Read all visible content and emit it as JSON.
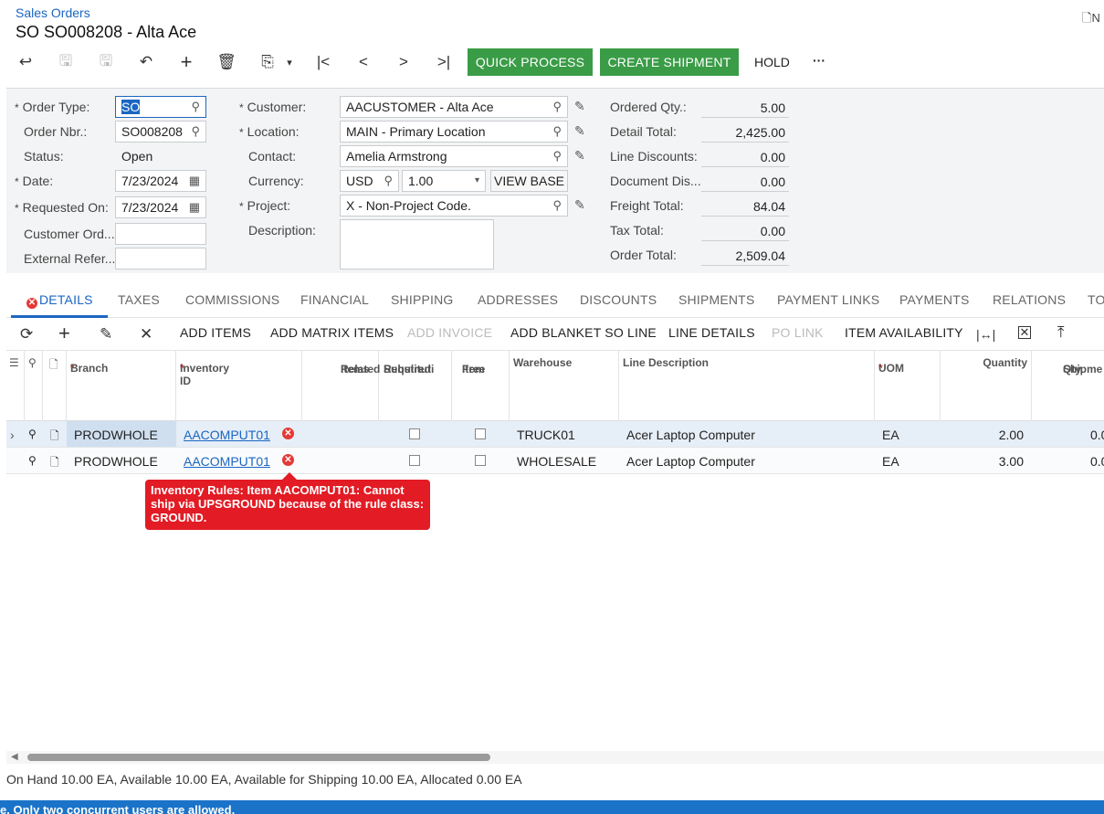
{
  "breadcrumb": "Sales Orders",
  "page_title": "SO SO008208 - Alta Ace",
  "notes_label": "N",
  "toolbar": {
    "quick_process": "QUICK PROCESS",
    "create_shipment": "CREATE SHIPMENT",
    "hold": "HOLD",
    "more": "···"
  },
  "form": {
    "order_type_label": "Order Type:",
    "order_type": "SO",
    "order_nbr_label": "Order Nbr.:",
    "order_nbr": "SO008208",
    "status_label": "Status:",
    "status": "Open",
    "date_label": "Date:",
    "date": "7/23/2024",
    "requested_on_label": "Requested On:",
    "requested_on": "7/23/2024",
    "customer_ord_label": "Customer Ord...",
    "external_ref_label": "External Refer...",
    "customer_label": "Customer:",
    "customer": "AACUSTOMER - Alta Ace",
    "location_label": "Location:",
    "location": "MAIN - Primary Location",
    "contact_label": "Contact:",
    "contact": "Amelia Armstrong",
    "currency_label": "Currency:",
    "currency": "USD",
    "rate": "1.00",
    "view_base": "VIEW BASE",
    "project_label": "Project:",
    "project": "X - Non-Project Code.",
    "description_label": "Description:"
  },
  "totals": {
    "ordered_qty_label": "Ordered Qty.:",
    "ordered_qty": "5.00",
    "detail_total_label": "Detail Total:",
    "detail_total": "2,425.00",
    "line_discounts_label": "Line Discounts:",
    "line_discounts": "0.00",
    "document_dis_label": "Document Dis...",
    "document_dis": "0.00",
    "freight_total_label": "Freight Total:",
    "freight_total": "84.04",
    "tax_total_label": "Tax Total:",
    "tax_total": "0.00",
    "order_total_label": "Order Total:",
    "order_total": "2,509.04"
  },
  "tabs": [
    "DETAILS",
    "TAXES",
    "COMMISSIONS",
    "FINANCIAL",
    "SHIPPING",
    "ADDRESSES",
    "DISCOUNTS",
    "SHIPMENTS",
    "PAYMENT LINKS",
    "PAYMENTS",
    "RELATIONS",
    "TO"
  ],
  "grid_toolbar": {
    "add_items": "ADD ITEMS",
    "add_matrix_items": "ADD MATRIX ITEMS",
    "add_invoice": "ADD INVOICE",
    "add_blanket": "ADD BLANKET SO LINE",
    "line_details": "LINE DETAILS",
    "po_link": "PO LINK",
    "item_availability": "ITEM AVAILABILITY"
  },
  "columns": {
    "branch": "Branch",
    "inventory_id": "Inventory ID",
    "related_items_1": "Related",
    "related_items_2": "Items",
    "substitution_1": "Substituti",
    "substitution_2": "Required",
    "free_item_1": "Free",
    "free_item_2": "Item",
    "warehouse": "Warehouse",
    "line_description": "Line Description",
    "uom": "UOM",
    "quantity": "Quantity",
    "qty_ship_1": "Qty.",
    "qty_ship_2": "Shipme"
  },
  "rows": [
    {
      "branch": "PRODWHOLE",
      "inventory_id": "AACOMPUT01",
      "warehouse": "TRUCK01",
      "description": "Acer Laptop Computer",
      "uom": "EA",
      "quantity": "2.00",
      "qty_ship": "0.0"
    },
    {
      "branch": "PRODWHOLE",
      "inventory_id": "AACOMPUT01",
      "warehouse": "WHOLESALE",
      "description": "Acer Laptop Computer",
      "uom": "EA",
      "quantity": "3.00",
      "qty_ship": "0.0"
    }
  ],
  "error_tooltip": "Inventory Rules: Item AACOMPUT01: Cannot ship via UPSGROUND because of the rule class: GROUND.",
  "status_line": "On Hand 10.00 EA, Available 10.00 EA, Available for Shipping 10.00 EA, Allocated 0.00 EA",
  "bottom_banner": "e. Only two concurrent users are allowed.",
  "colors": {
    "accent": "#1a66c2",
    "green": "#3a9c47",
    "error": "#e21b24"
  }
}
